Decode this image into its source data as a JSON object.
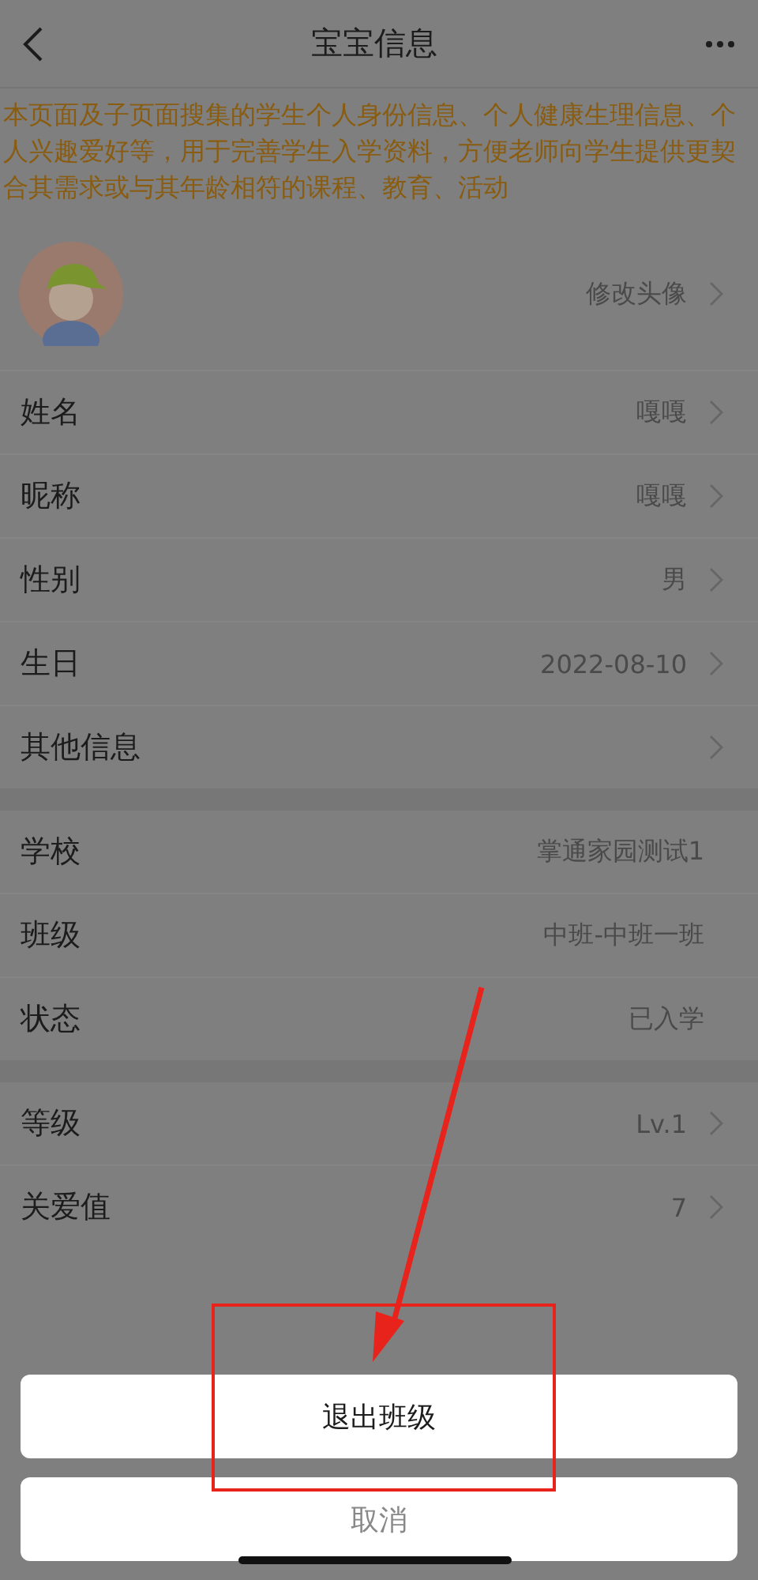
{
  "nav": {
    "title": "宝宝信息"
  },
  "notice": "本页面及子页面搜集的学生个人身份信息、个人健康生理信息、个人兴趣爱好等，用于完善学生入学资料，方便老师向学生提供更契合其需求或与其年龄相符的课程、教育、活动",
  "avatar_row": {
    "action": "修改头像",
    "chevron": true
  },
  "sections": [
    [
      {
        "label": "姓名",
        "value": "嘎嘎",
        "chevron": true
      },
      {
        "label": "昵称",
        "value": "嘎嘎",
        "chevron": true
      },
      {
        "label": "性别",
        "value": "男",
        "chevron": true
      },
      {
        "label": "生日",
        "value": "2022-08-10",
        "chevron": true
      },
      {
        "label": "其他信息",
        "chevron": true
      }
    ],
    [
      {
        "label": "学校",
        "value": "掌通家园测试1",
        "chevron": false
      },
      {
        "label": "班级",
        "value": "中班-中班一班",
        "chevron": false
      },
      {
        "label": "状态",
        "value": "已入学",
        "chevron": false
      }
    ],
    [
      {
        "label": "等级",
        "value": "Lv.1",
        "chevron": true
      },
      {
        "label": "关爱值",
        "value": "7",
        "chevron": true
      }
    ]
  ],
  "action_sheet": {
    "buttons": [
      {
        "label": "退出班级",
        "kind": "primary"
      },
      {
        "label": "取消",
        "kind": "cancel"
      }
    ]
  }
}
